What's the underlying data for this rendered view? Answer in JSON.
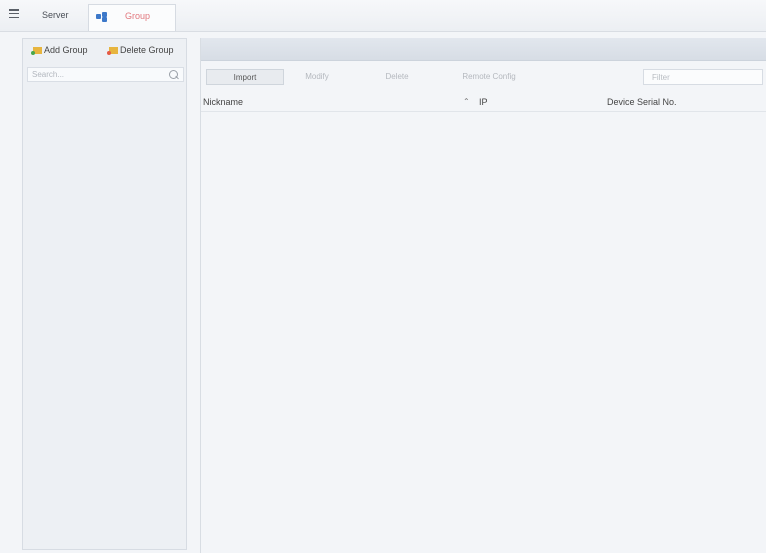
{
  "topbar": {
    "tabs": [
      {
        "label": "Server"
      },
      {
        "label": "Group"
      }
    ]
  },
  "left_panel": {
    "add_group_label": "Add Group",
    "delete_group_label": "Delete Group",
    "search": {
      "placeholder": "Search...",
      "value": ""
    }
  },
  "main": {
    "actions": {
      "import": "Import",
      "modify": "Modify",
      "delete": "Delete",
      "remote_config": "Remote Config"
    },
    "filter": {
      "placeholder": "Filter",
      "value": ""
    },
    "table": {
      "columns": [
        "Nickname",
        "IP",
        "Device Serial No."
      ],
      "rows": []
    }
  },
  "colors": {
    "active_tab_text": "#e2787e",
    "group_icon": "#3c78c9",
    "folder": "#e7b53f"
  },
  "icons": [
    "menu-icon",
    "group-icon",
    "folder-add-icon",
    "folder-delete-icon",
    "search-icon",
    "sort-icon"
  ]
}
